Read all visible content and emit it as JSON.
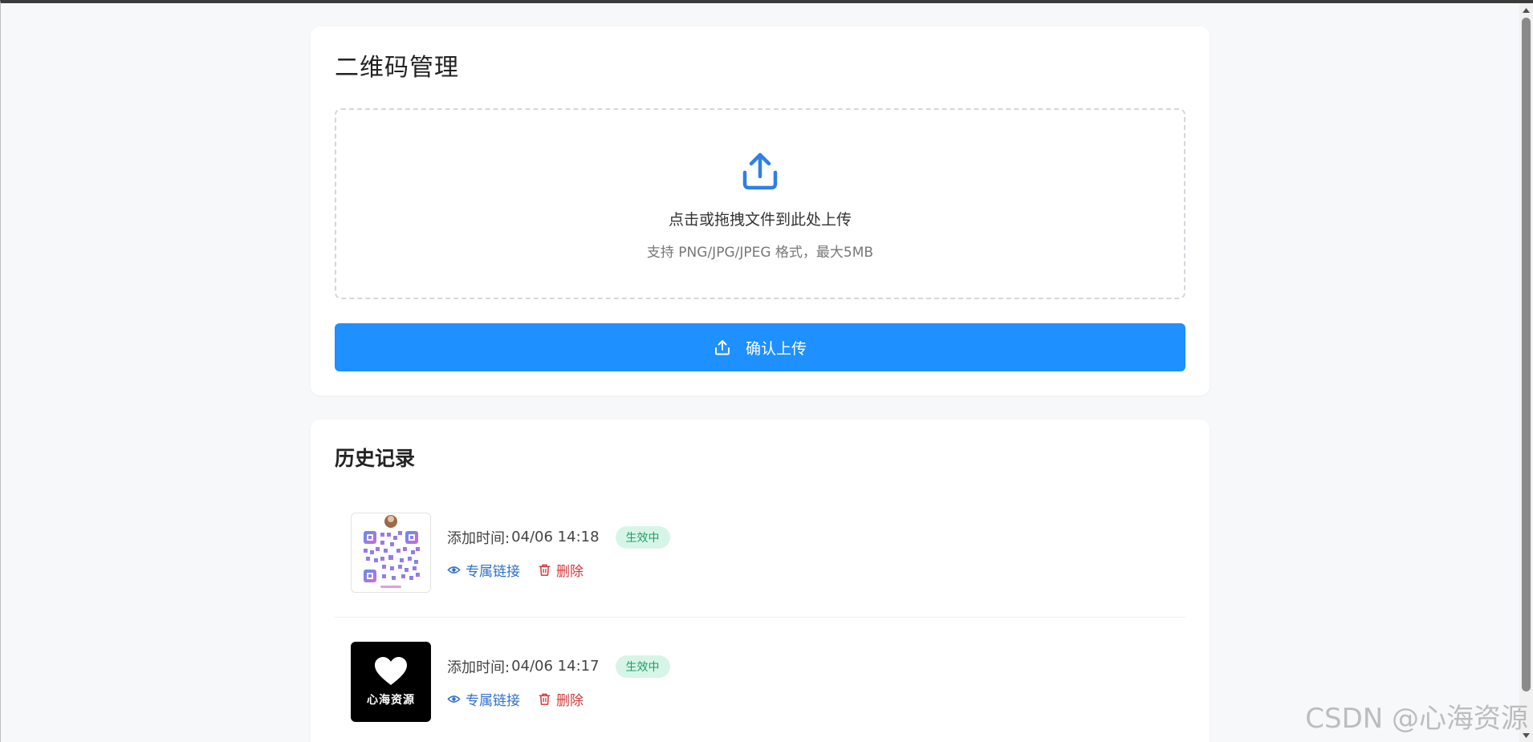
{
  "upload": {
    "title": "二维码管理",
    "drop_main": "点击或拖拽文件到此处上传",
    "drop_sub": "支持 PNG/JPG/JPEG 格式，最大5MB",
    "confirm_label": "确认上传"
  },
  "history": {
    "title": "历史记录",
    "items": [
      {
        "time_label": "添加时间:",
        "time_value": "04/06 14:18",
        "status": "生效中",
        "link_label": "专属链接",
        "delete_label": "删除"
      },
      {
        "time_label": "添加时间:",
        "time_value": "04/06 14:17",
        "status": "生效中",
        "link_label": "专属链接",
        "delete_label": "删除",
        "thumb_text": "心海资源"
      }
    ]
  },
  "watermark": "CSDN @心海资源",
  "colors": {
    "primary": "#1e90ff",
    "badge_bg": "#d7f5e7",
    "badge_text": "#1f9d65",
    "link": "#2f6fcc",
    "danger": "#d23a3a"
  }
}
